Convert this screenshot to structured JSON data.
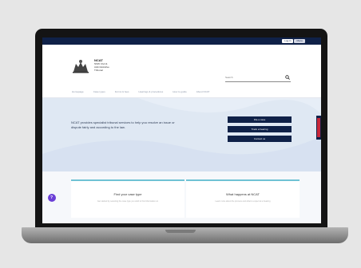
{
  "colors": {
    "brand_navy": "#0f2148",
    "hero_bg": "#dfe8f3",
    "accent_teal": "#6fc2d4",
    "chat_purple": "#6b3fd6",
    "alert_red": "#c8273a"
  },
  "utility": {
    "btn1": "Log in",
    "btn2": "Menu"
  },
  "logo": {
    "line1": "NCAT",
    "line2": "NSW Civil &",
    "line3": "Administrative",
    "line4": "Tribunal"
  },
  "search": {
    "placeholder": "Search"
  },
  "nav": {
    "items": [
      "Homepage",
      "Case types",
      "Forms & fees",
      "Hearings & procedures",
      "How to guide",
      "About NCAT"
    ]
  },
  "hero": {
    "text": "NCAT provides specialist tribunal services to help you resolve an issue or dispute fairly and according to the law.",
    "buttons": [
      "File a case",
      "Track a hearing",
      "Contact us"
    ]
  },
  "cards": [
    {
      "title": "Find your case type",
      "subtitle": "Get started by selecting the case type you wish to find information on"
    },
    {
      "title": "What happens at NCAT",
      "subtitle": "Learn more about the process and what to expect at a hearing"
    }
  ],
  "icons": {
    "logo": "coat-of-arms-icon",
    "search": "search-icon",
    "chat": "chat-icon"
  }
}
